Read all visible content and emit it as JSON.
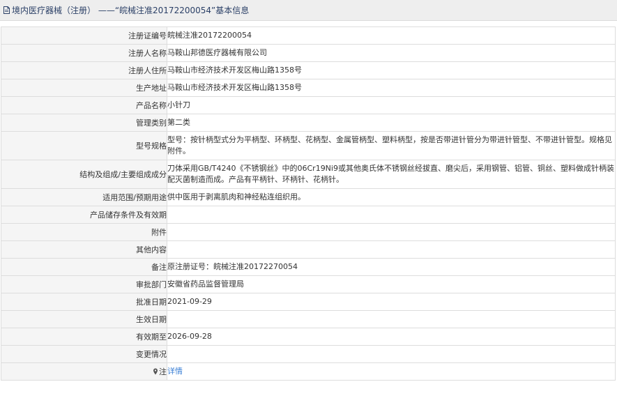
{
  "header": {
    "title": "境内医疗器械（注册） ——“皖械注准20172200054”基本信息"
  },
  "rows": [
    {
      "label": "注册证编号",
      "value": "皖械注准20172200054"
    },
    {
      "label": "注册人名称",
      "value": "马鞍山邦德医疗器械有限公司"
    },
    {
      "label": "注册人住所",
      "value": "马鞍山市经济技术开发区梅山路1358号"
    },
    {
      "label": "生产地址",
      "value": "马鞍山市经济技术开发区梅山路1358号"
    },
    {
      "label": "产品名称",
      "value": "小针刀"
    },
    {
      "label": "管理类别",
      "value": "第二类"
    },
    {
      "label": "型号规格",
      "value": "型号：按针柄型式分为平柄型、环柄型、花柄型、金属管柄型、塑料柄型，按是否带进针管分为带进针管型、不带进针管型。规格见附件。"
    },
    {
      "label": "结构及组成/主要组成成分",
      "value": "刀体采用GB/T4240《不锈钢丝》中的06Cr19Ni9或其他奥氏体不锈钢丝经拔直、磨尖后，采用钢管、铝管、铜丝、塑料做成针柄装配灭菌制造而成。产品有平柄针、环柄针、花柄针。"
    },
    {
      "label": "适用范围/预期用途",
      "value": "供中医用于剥离肌肉和神经粘连组织用。"
    },
    {
      "label": "产品储存条件及有效期",
      "value": ""
    },
    {
      "label": "附件",
      "value": ""
    },
    {
      "label": "其他内容",
      "value": ""
    },
    {
      "label": "备注",
      "value": "原注册证号：皖械注准20172270054"
    },
    {
      "label": "审批部门",
      "value": "安徽省药品监督管理局"
    },
    {
      "label": "批准日期",
      "value": "2021-09-29"
    },
    {
      "label": "生效日期",
      "value": ""
    },
    {
      "label": "有效期至",
      "value": "2026-09-28"
    },
    {
      "label": "变更情况",
      "value": ""
    }
  ],
  "note": {
    "label": "注",
    "link_text": "详情"
  },
  "colors": {
    "header_text": "#2a3f66",
    "link": "#3a7fd5",
    "label_bg": "#f5f5f5"
  }
}
